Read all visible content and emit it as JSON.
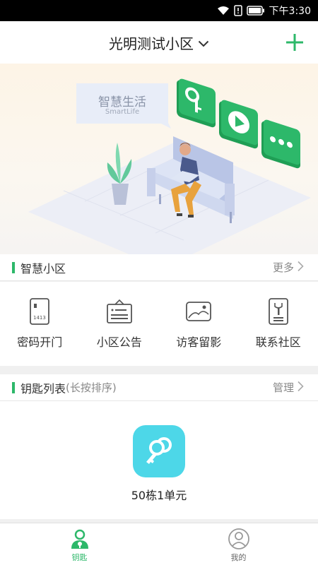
{
  "status": {
    "time": "下午3:30",
    "icons": [
      "wifi-icon",
      "sim-alert-icon",
      "battery-icon"
    ]
  },
  "header": {
    "community": "光明测试小区",
    "add_icon": "plus-icon",
    "accent": "#2db86a"
  },
  "banner": {
    "title": "智慧生活",
    "subtitle": "SmartLife"
  },
  "smart": {
    "title": "智慧小区",
    "more": "更多",
    "items": [
      {
        "label": "密码开门",
        "icon": "keypad-icon"
      },
      {
        "label": "小区公告",
        "icon": "notice-board-icon"
      },
      {
        "label": "访客留影",
        "icon": "photo-icon"
      },
      {
        "label": "联系社区",
        "icon": "contact-icon"
      }
    ]
  },
  "keys": {
    "title": "钥匙列表",
    "hint": "(长按排序)",
    "manage": "管理",
    "items": [
      {
        "name": "50栋1单元",
        "color": "#4dd7e8"
      }
    ]
  },
  "tabbar": {
    "tabs": [
      {
        "label": "钥匙",
        "active": true,
        "icon": "key-person-icon"
      },
      {
        "label": "我的",
        "active": false,
        "icon": "profile-icon"
      }
    ]
  }
}
